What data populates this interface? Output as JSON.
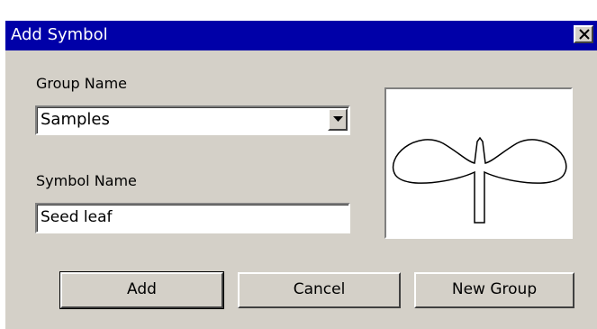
{
  "window": {
    "title": "Add Symbol"
  },
  "titlebar": {
    "close_icon": "close-x-icon"
  },
  "group": {
    "label": "Group Name",
    "selected": "Samples",
    "dropdown_icon": "chevron-down-icon"
  },
  "symbol": {
    "label": "Symbol Name",
    "value": "Seed leaf"
  },
  "preview": {
    "icon": "seed-leaf-symbol"
  },
  "buttons": {
    "add": "Add",
    "cancel": "Cancel",
    "new_group": "New Group"
  },
  "colors": {
    "titlebar": "#0000a8",
    "face": "#d4d0c8"
  }
}
